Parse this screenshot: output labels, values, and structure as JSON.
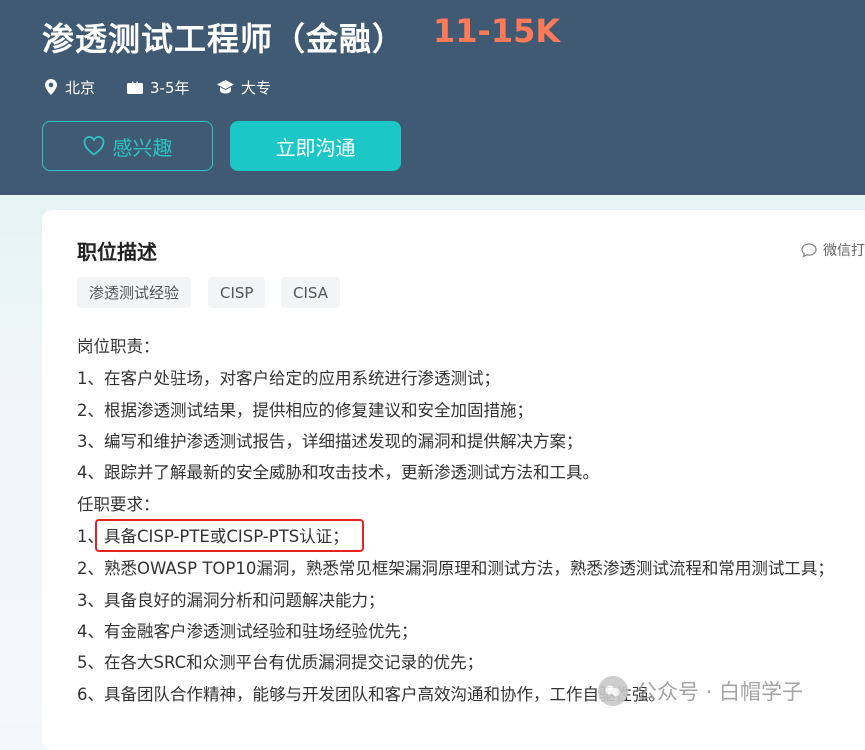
{
  "header": {
    "title": "渗透测试工程师（金融）",
    "salary": "11-15K",
    "location": "北京",
    "experience": "3-5年",
    "education": "大专",
    "interest_label": "感兴趣",
    "chat_label": "立即沟通"
  },
  "description": {
    "section_title": "职位描述",
    "share_label": "微信打",
    "tags": [
      "渗透测试经验",
      "CISP",
      "CISA"
    ],
    "lines": [
      "岗位职责：",
      "1、在客户处驻场，对客户给定的应用系统进行渗透测试；",
      "2、根据渗透测试结果，提供相应的修复建议和安全加固措施；",
      "3、编写和维护渗透测试报告，详细描述发现的漏洞和提供解决方案；",
      "4、跟踪并了解最新的安全威胁和攻击技术，更新渗透测试方法和工具。",
      "任职要求：",
      "1、具备CISP-PTE或CISP-PTS认证；",
      "2、熟悉OWASP TOP10漏洞，熟悉常见框架漏洞原理和测试方法，熟悉渗透测试流程和常用测试工具；",
      "3、具备良好的漏洞分析和问题解决能力；",
      "4、有金融客户渗透测试经验和驻场经验优先；",
      "5、在各大SRC和众测平台有优质漏洞提交记录的优先；",
      "6、具备团队合作精神，能够与开发团队和客户高效沟通和协作，工作自驱性强。"
    ]
  },
  "watermark": {
    "text": "公众号 · 白帽学子"
  },
  "colors": {
    "header_bg": "#3f5a72",
    "salary": "#ff7a59",
    "accent": "#1cc7c7",
    "highlight": "#e8231f"
  },
  "icons": {
    "location": "map-pin-icon",
    "experience": "briefcase-icon",
    "education": "graduation-cap-icon",
    "interest": "heart-icon",
    "share": "chat-bubble-icon"
  }
}
